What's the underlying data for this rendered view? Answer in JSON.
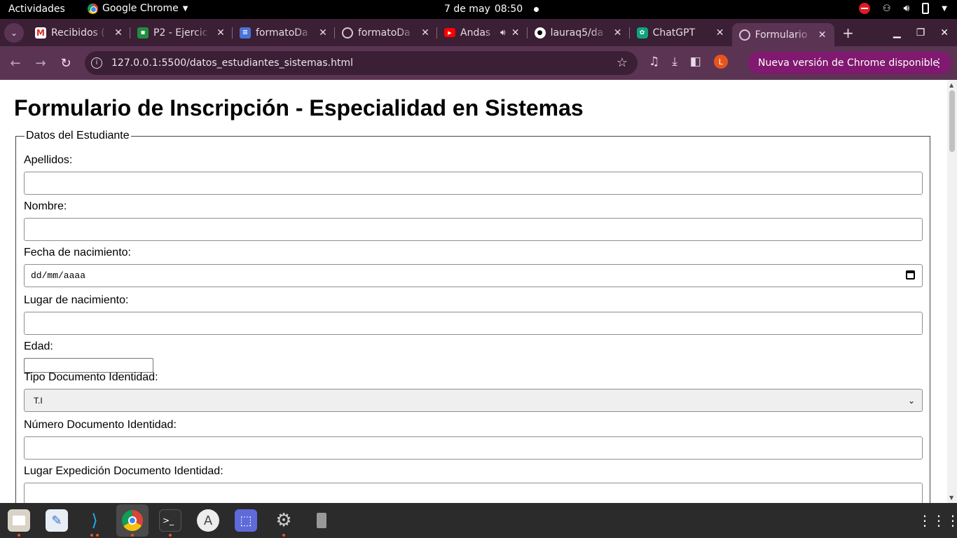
{
  "topbar": {
    "activities": "Actividades",
    "app_name": "Google Chrome",
    "date": "7 de may",
    "time": "08:50"
  },
  "tabs": [
    {
      "icon": "gmail-icon",
      "title": "Recibidos (",
      "active": false
    },
    {
      "icon": "classroom-icon",
      "title": "P2 - Ejercic",
      "active": false
    },
    {
      "icon": "docs-icon",
      "title": "formatoDa",
      "active": false
    },
    {
      "icon": "globe-icon",
      "title": "formatoDa",
      "active": false
    },
    {
      "icon": "youtube-icon",
      "title": "Andas e",
      "active": false,
      "audio": true
    },
    {
      "icon": "github-icon",
      "title": "lauraq5/da",
      "active": false
    },
    {
      "icon": "chatgpt-icon",
      "title": "ChatGPT",
      "active": false
    },
    {
      "icon": "globe-icon",
      "title": "Formulario",
      "active": true
    }
  ],
  "toolbar": {
    "url": "127.0.0.1:5500/datos_estudiantes_sistemas.html",
    "profile_initial": "L",
    "update_label": "Nueva versión de Chrome disponible"
  },
  "page": {
    "title": "Formulario de Inscripción - Especialidad en Sistemas",
    "legend": "Datos del Estudiante",
    "fields": {
      "apellidos": {
        "label": "Apellidos:",
        "value": ""
      },
      "nombre": {
        "label": "Nombre:",
        "value": ""
      },
      "fecha_nacimiento": {
        "label": "Fecha de nacimiento:",
        "placeholder": "dd/mm/aaaa"
      },
      "lugar_nacimiento": {
        "label": "Lugar de nacimiento:",
        "value": ""
      },
      "edad": {
        "label": "Edad:",
        "value": ""
      },
      "tipo_documento": {
        "label": "Tipo Documento Identidad:",
        "selected": "T.I"
      },
      "numero_documento": {
        "label": "Número Documento Identidad:",
        "value": ""
      },
      "lugar_expedicion": {
        "label": "Lugar Expedición Documento Identidad:",
        "value": ""
      }
    }
  },
  "dock": [
    "files-icon",
    "text-editor-icon",
    "vscode-icon",
    "chrome-icon",
    "terminal-icon",
    "software-icon",
    "screenshot-icon",
    "settings-icon",
    "trash-icon",
    "app-grid-icon"
  ],
  "colors": {
    "tabstrip": "#3a1f35",
    "toolbar": "#5b3454",
    "update_chip": "#80196f"
  }
}
